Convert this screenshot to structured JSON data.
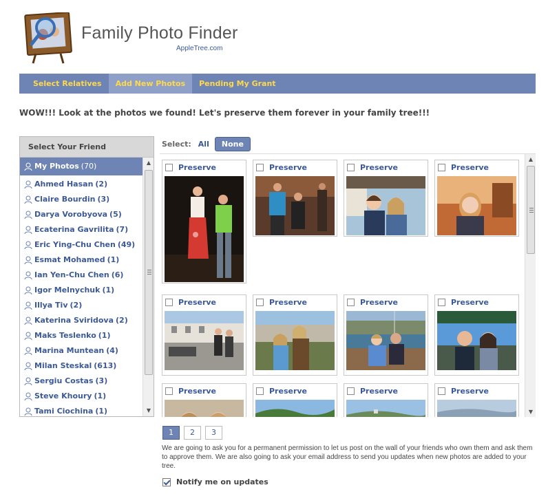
{
  "header": {
    "title": "Family Photo Finder",
    "subtitle": "AppleTree.com"
  },
  "nav": [
    {
      "label": "Select Relatives"
    },
    {
      "label": "Add New Photos",
      "active": true
    },
    {
      "label": "Pending My Grant"
    }
  ],
  "headline": "WOW!!! Look at the photos we found! Let's preserve them forever in your family tree!!!",
  "sidebar": {
    "title": "Select Your Friend",
    "friends": [
      {
        "name": "My Photos",
        "count": "(70)",
        "active": true
      },
      {
        "name": "Ahmed Hasan",
        "count": "(2)"
      },
      {
        "name": "Claire Bourdin",
        "count": "(3)"
      },
      {
        "name": "Darya Vorobyova",
        "count": "(5)"
      },
      {
        "name": "Ecaterina Gavrilita",
        "count": "(7)"
      },
      {
        "name": "Eric Ying-Chu Chen",
        "count": "(49)"
      },
      {
        "name": "Esmat Mohamed",
        "count": "(1)"
      },
      {
        "name": "Ian Yen-Chu Chen",
        "count": "(6)"
      },
      {
        "name": "Igor Melnychuk",
        "count": "(1)"
      },
      {
        "name": "Illya Tiv",
        "count": "(2)"
      },
      {
        "name": "Katerina Sviridova",
        "count": "(2)"
      },
      {
        "name": "Maks Teslenko",
        "count": "(1)"
      },
      {
        "name": "Marina Muntean",
        "count": "(4)"
      },
      {
        "name": "Milan Steskal",
        "count": "(613)"
      },
      {
        "name": "Sergiu Costas",
        "count": "(3)"
      },
      {
        "name": "Steve Khoury",
        "count": "(1)"
      },
      {
        "name": "Tami Ciochina",
        "count": "(1)"
      }
    ]
  },
  "select": {
    "label": "Select:",
    "all": "All",
    "none": "None"
  },
  "photos": {
    "preserve_label": "Preserve",
    "cards": [
      {
        "scene": "dance-night"
      },
      {
        "scene": "dance-bar"
      },
      {
        "scene": "cafe-couple"
      },
      {
        "scene": "armchair-girl"
      },
      {
        "scene": "harbor-street"
      },
      {
        "scene": "sunny-hill"
      },
      {
        "scene": "boat-deck"
      },
      {
        "scene": "sea-couple"
      },
      {
        "scene": "portrait-pair"
      },
      {
        "scene": "green-hills"
      },
      {
        "scene": "seaside-town"
      },
      {
        "scene": "misty-coast"
      }
    ]
  },
  "pager": [
    "1",
    "2",
    "3"
  ],
  "note": "We are going to ask you for a permanent permission to let us post on the wall of your friends who own them and ask them to approve them. We are also going to ask your email address to send you updates when new photos are added to your tree.",
  "notify_label": "Notify me on updates",
  "colors": {
    "nav_bg": "#6d84b4",
    "nav_text": "#ffd94a",
    "link": "#3b5998"
  }
}
